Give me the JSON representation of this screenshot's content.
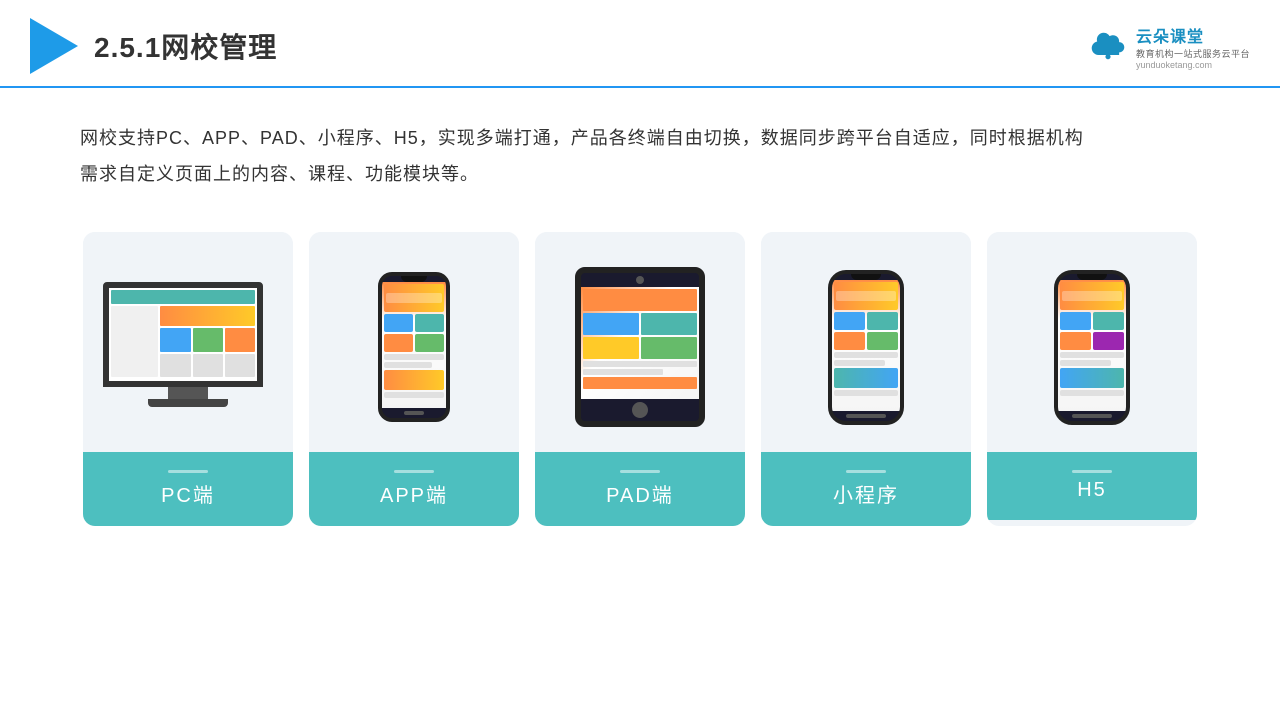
{
  "header": {
    "title": "2.5.1网校管理",
    "brand": {
      "name": "云朵课堂",
      "sub": "教育机构一站式服务云平台",
      "url": "yunduoketang.com"
    }
  },
  "description": {
    "text": "网校支持PC、APP、PAD、小程序、H5，实现多端打通，产品各终端自由切换，数据同步跨平台自适应，同时根据机构需求自定义页面上的内容、课程、功能模块等。"
  },
  "cards": [
    {
      "id": "pc",
      "label": "PC端",
      "type": "monitor"
    },
    {
      "id": "app",
      "label": "APP端",
      "type": "phone"
    },
    {
      "id": "pad",
      "label": "PAD端",
      "type": "tablet"
    },
    {
      "id": "mini",
      "label": "小程序",
      "type": "phone"
    },
    {
      "id": "h5",
      "label": "H5",
      "type": "phone"
    }
  ],
  "colors": {
    "accent": "#4dbfbf",
    "border": "#2196F3",
    "title": "#333333"
  }
}
